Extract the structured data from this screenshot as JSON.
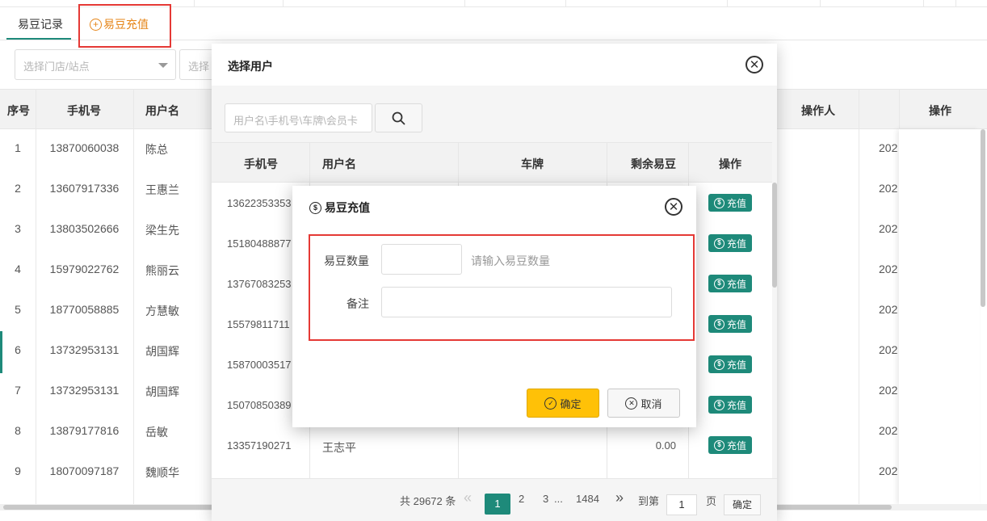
{
  "tabs": {
    "records": "易豆记录",
    "recharge": "易豆充值",
    "plus": "+"
  },
  "filters": {
    "store_placeholder": "选择门店/站点",
    "second_placeholder": "选择"
  },
  "bg_table": {
    "headers": {
      "no": "序号",
      "phone": "手机号",
      "name": "用户名",
      "operator": "操作人",
      "action": "操作"
    },
    "rows": [
      {
        "no": "1",
        "phone": "13870060038",
        "name": "陈总",
        "date": "202"
      },
      {
        "no": "2",
        "phone": "13607917336",
        "name": "王惠兰",
        "date": "202"
      },
      {
        "no": "3",
        "phone": "13803502666",
        "name": "梁生先",
        "date": "202"
      },
      {
        "no": "4",
        "phone": "15979022762",
        "name": "熊丽云",
        "date": "202"
      },
      {
        "no": "5",
        "phone": "18770058885",
        "name": "方慧敏",
        "date": "202"
      },
      {
        "no": "6",
        "phone": "13732953131",
        "name": "胡国辉",
        "date": "202"
      },
      {
        "no": "7",
        "phone": "13732953131",
        "name": "胡国辉",
        "date": "202"
      },
      {
        "no": "8",
        "phone": "13879177816",
        "name": "岳敏",
        "date": "202"
      },
      {
        "no": "9",
        "phone": "18070097187",
        "name": "魏顺华",
        "date": "202"
      }
    ]
  },
  "select_user": {
    "title": "选择用户",
    "search_placeholder": "用户名\\手机号\\车牌\\会员卡",
    "headers": {
      "phone": "手机号",
      "name": "用户名",
      "plate": "车牌",
      "beans": "剩余易豆",
      "action": "操作"
    },
    "recharge_label": "充值",
    "rows": [
      {
        "phone": "13622353353",
        "name": "",
        "beans": ""
      },
      {
        "phone": "15180488877",
        "name": "",
        "beans": ""
      },
      {
        "phone": "13767083253",
        "name": "",
        "beans": ""
      },
      {
        "phone": "15579811711",
        "name": "",
        "beans": ""
      },
      {
        "phone": "15870003517",
        "name": "",
        "beans": ""
      },
      {
        "phone": "15070850389",
        "name": "",
        "beans": ""
      },
      {
        "phone": "13357190271",
        "name": "王志平",
        "beans": "0.00"
      }
    ],
    "pager": {
      "total": "共 29672 条",
      "prev": "«",
      "pages": [
        "1",
        "2",
        "3",
        "...",
        "1484"
      ],
      "next": "»",
      "goto_label": "到第",
      "goto_value": "1",
      "page_unit": "页",
      "confirm": "确定"
    }
  },
  "recharge_dialog": {
    "title": "易豆充值",
    "qty_label": "易豆数量",
    "qty_value": "",
    "qty_hint": "请输入易豆数量",
    "remark_label": "备注",
    "remark_value": "",
    "ok_label": "确定",
    "cancel_label": "取消"
  },
  "colors": {
    "accent": "#1e8a7a",
    "highlight": "#e53935",
    "tab_active": "#e6861a",
    "confirm": "#ffc107"
  },
  "icons": {
    "close": "close-icon",
    "coin": "coin-icon",
    "search": "search-icon",
    "check": "check-icon"
  }
}
